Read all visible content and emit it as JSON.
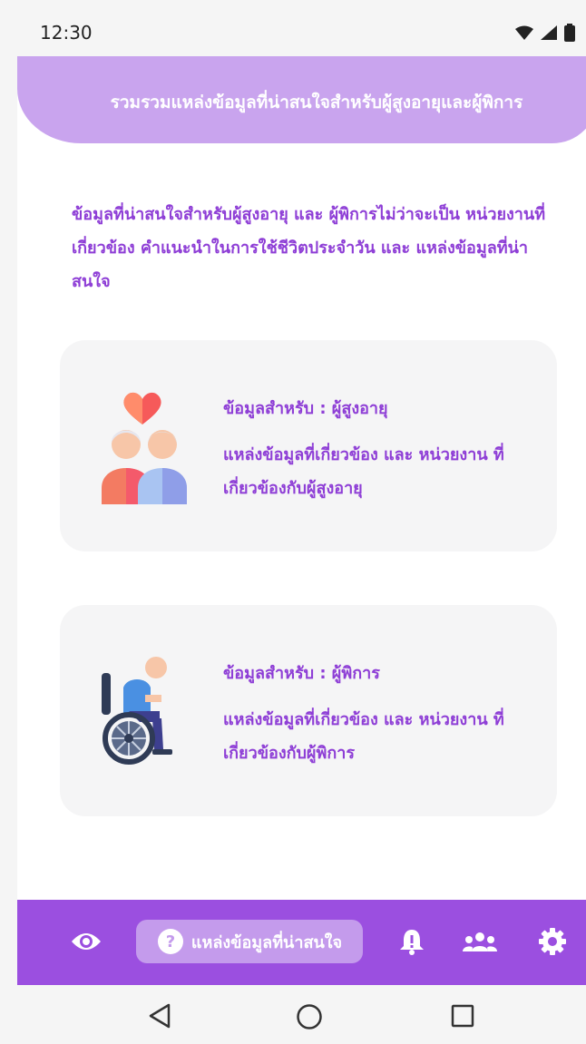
{
  "status": {
    "time": "12:30"
  },
  "header": {
    "title": "รวมรวมแหล่งข้อมูลที่น่าสนใจสำหรับผู้สูงอายุและผู้พิการ"
  },
  "intro": "ข้อมูลที่น่าสนใจสำหรับผู้สูงอายุ และ ผู้พิการไม่ว่าจะเป็น หน่วยงานที่เกี่ยวข้อง คำแนะนำในการใช้ชีวิตประจำวัน และ แหล่งข้อมูลที่น่าสนใจ",
  "cards": [
    {
      "title": "ข้อมูลสำหรับ : ผู้สูงอายุ",
      "description": "แหล่งข้อมูลที่เกี่ยวข้อง และ หน่วยงาน ที่เกี่ยวข้องกับผู้สูงอายุ",
      "icon": "elderly-couple-heart-icon"
    },
    {
      "title": "ข้อมูลสำหรับ : ผู้พิการ",
      "description": "แหล่งข้อมูลที่เกี่ยวข้อง และ หน่วยงาน ที่เกี่ยวข้องกับผู้พิการ",
      "icon": "wheelchair-user-icon"
    }
  ],
  "bottom_nav": {
    "items": [
      {
        "icon": "eye-icon"
      },
      {
        "icon": "help-circle-icon",
        "label": "แหล่งข้อมูลที่น่าสนใจ",
        "active": true
      },
      {
        "icon": "alert-bell-icon"
      },
      {
        "icon": "group-icon"
      },
      {
        "icon": "gear-icon"
      }
    ]
  },
  "colors": {
    "accent": "#9b4fe0",
    "header": "#c9a4ee",
    "text_purple": "#8e3ed6"
  }
}
